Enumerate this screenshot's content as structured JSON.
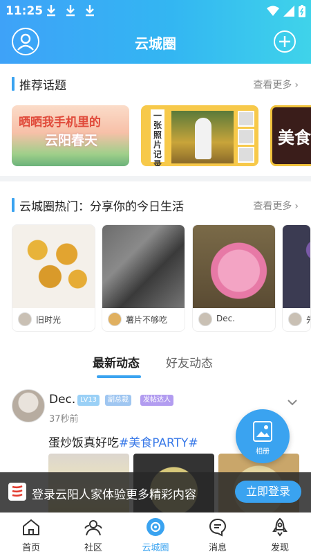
{
  "status_bar": {
    "time": "11:25"
  },
  "header": {
    "title": "云城圈"
  },
  "topics_section": {
    "title": "推荐话题",
    "more": "查看更多",
    "cards": [
      {
        "line1": "晒晒我手机里的",
        "line2": "云阳春天"
      },
      {
        "vertical_text": "一张照片记录生活"
      },
      {
        "text": "美食"
      }
    ]
  },
  "hot_section": {
    "title": "云城圈热门：分享你的今日生活",
    "more": "查看更多",
    "cards": [
      {
        "user": "旧时光"
      },
      {
        "user": "薯片不够吃"
      },
      {
        "user": "Dec."
      },
      {
        "user": "先"
      }
    ]
  },
  "tabs": {
    "latest": "最新动态",
    "friends": "好友动态"
  },
  "post": {
    "user": "Dec.",
    "badges": {
      "level": "LV13",
      "role": "副总裁",
      "title": "发帖达人"
    },
    "time": "37秒前",
    "text": "蛋炒饭真好吃",
    "tag": "#美食PARTY#"
  },
  "album_button": {
    "label": "相册"
  },
  "login_banner": {
    "text": "登录云阳人家体验更多精彩内容",
    "button": "立即登录"
  },
  "bottom_nav": {
    "items": [
      {
        "label": "首页"
      },
      {
        "label": "社区"
      },
      {
        "label": "云城圈"
      },
      {
        "label": "消息"
      },
      {
        "label": "发现"
      }
    ],
    "active_index": 2
  },
  "colors": {
    "accent": "#3aa3f0",
    "tag": "#3a7ae8",
    "lv_badge": "#9ad0f6",
    "poster_badge": "#b29cf0"
  }
}
